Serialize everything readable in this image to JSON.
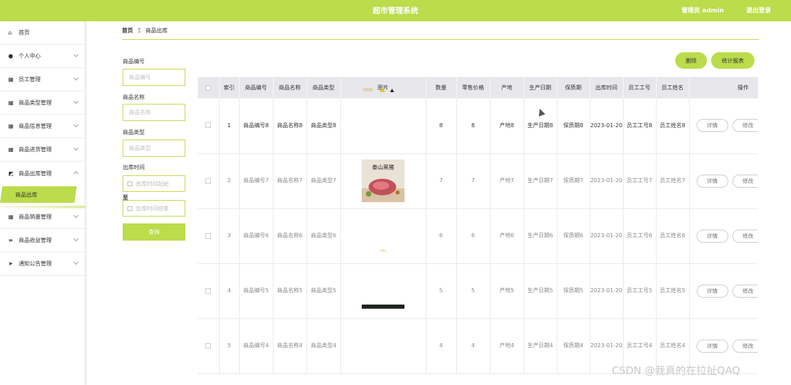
{
  "header": {
    "title": "超市管理系统",
    "user": "管理员 admin",
    "logout": "退出登录",
    "accent": "#bbdc4b"
  },
  "sidebar": {
    "items": [
      {
        "label": "首页",
        "icon": "home-icon"
      },
      {
        "label": "个人中心",
        "icon": "user-icon"
      },
      {
        "label": "员工管理",
        "icon": "grid-icon"
      },
      {
        "label": "商品类型管理",
        "icon": "grid-icon"
      },
      {
        "label": "商品信息管理",
        "icon": "grid-icon"
      },
      {
        "label": "商品进货管理",
        "icon": "grid-icon"
      },
      {
        "label": "商品出库管理",
        "icon": "chart-icon"
      },
      {
        "label": "商品销量管理",
        "icon": "grid-icon"
      },
      {
        "label": "商品收益管理",
        "icon": "list-icon"
      },
      {
        "label": "通知公告管理",
        "icon": "send-icon"
      }
    ],
    "active_sub": "商品出库"
  },
  "breadcrumb": {
    "home": "首页",
    "sep": "Ξ",
    "current": "商品出库"
  },
  "filters": {
    "code_label": "商品编号",
    "code_placeholder": "商品编号",
    "name_label": "商品名称",
    "name_placeholder": "商品名称",
    "type_label": "商品类型",
    "type_placeholder": "商品类型",
    "time_label": "出库时间",
    "start_placeholder": "出库时间起始",
    "to_label": "至",
    "end_placeholder": "出库时间结束",
    "search": "查询"
  },
  "actions": {
    "delete": "删除",
    "report": "统计报表"
  },
  "table": {
    "headers": [
      "索引",
      "商品编号",
      "商品名称",
      "商品类型",
      "图片",
      "数量",
      "零售价格",
      "产地",
      "生产日期",
      "保质期",
      "出库时间",
      "员工工号",
      "员工姓名",
      "操作"
    ],
    "rows": [
      {
        "idx": "1",
        "code": "商品编号8",
        "name": "商品名称8",
        "type": "商品类型8",
        "qty": "8",
        "price": "8",
        "origin": "产地8",
        "mfg": "生产日期8",
        "shelf": "保质期8",
        "time": "2023-01-20",
        "empno": "员工工号8",
        "empname": "员工姓名8"
      },
      {
        "idx": "2",
        "code": "商品编号7",
        "name": "商品名称7",
        "type": "商品类型7",
        "qty": "7",
        "price": "7",
        "origin": "产地7",
        "mfg": "生产日期7",
        "shelf": "保质期7",
        "time": "2023-01-20",
        "empno": "员工工号7",
        "empname": "员工姓名7"
      },
      {
        "idx": "3",
        "code": "商品编号6",
        "name": "商品名称6",
        "type": "商品类型6",
        "qty": "6",
        "price": "6",
        "origin": "产地6",
        "mfg": "生产日期6",
        "shelf": "保质期6",
        "time": "2023-01-20",
        "empno": "员工工号6",
        "empname": "员工姓名6"
      },
      {
        "idx": "4",
        "code": "商品编号5",
        "name": "商品名称5",
        "type": "商品类型5",
        "qty": "5",
        "price": "5",
        "origin": "产地5",
        "mfg": "生产日期5",
        "shelf": "保质期5",
        "time": "2023-01-20",
        "empno": "员工工号5",
        "empname": "员工姓名5"
      },
      {
        "idx": "5",
        "code": "商品编号4",
        "name": "商品名称4",
        "type": "商品类型4",
        "qty": "4",
        "price": "4",
        "origin": "产地4",
        "mfg": "生产日期4",
        "shelf": "保质期4",
        "time": "2023-01-20",
        "empno": "员工工号4",
        "empname": "员工姓名4"
      }
    ],
    "detail": "详情",
    "edit": "修改",
    "image_text": "泰山黑猪"
  },
  "watermark": "CSDN @我真的在拉扯QAQ"
}
